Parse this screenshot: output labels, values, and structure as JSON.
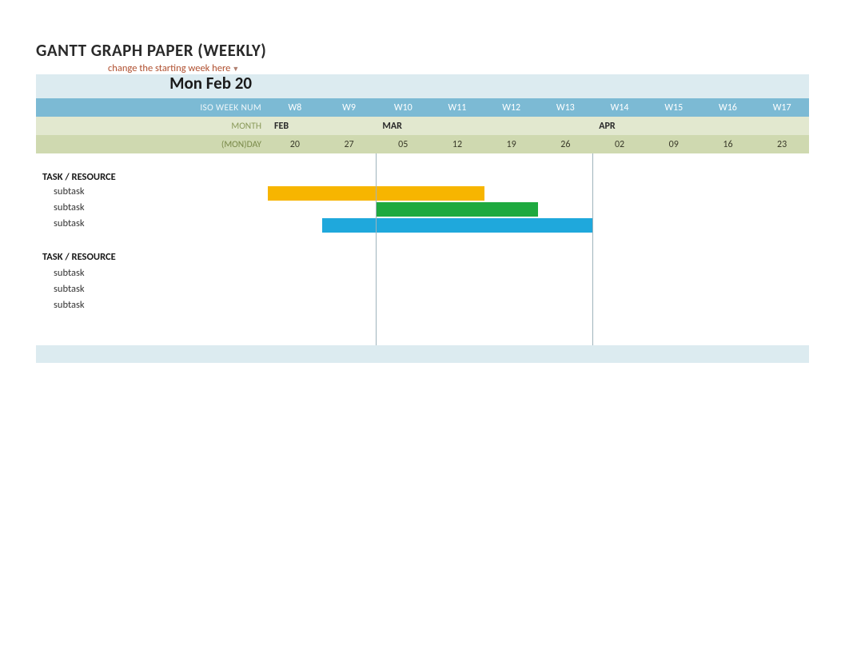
{
  "title": "GANTT GRAPH PAPER (WEEKLY)",
  "hint": "change the starting week here",
  "start_date": "Mon Feb 20",
  "header": {
    "iso_week_label": "ISO WEEK NUM",
    "month_label": "MONTH",
    "day_label": "(MON)DAY"
  },
  "weeks": [
    "W8",
    "W9",
    "W10",
    "W11",
    "W12",
    "W13",
    "W14",
    "W15",
    "W16",
    "W17"
  ],
  "months": [
    "FEB",
    "",
    "MAR",
    "",
    "",
    "",
    "APR",
    "",
    "",
    ""
  ],
  "month_bold": [
    true,
    false,
    true,
    false,
    false,
    false,
    true,
    false,
    false,
    false
  ],
  "month_boundaries": [
    2,
    6
  ],
  "days": [
    "20",
    "27",
    "05",
    "12",
    "19",
    "26",
    "02",
    "09",
    "16",
    "23"
  ],
  "sections": [
    {
      "heading": "TASK / RESOURCE",
      "rows": [
        {
          "label": "subtask",
          "bar": {
            "start": 0,
            "span": 4,
            "color": "yellow"
          }
        },
        {
          "label": "subtask",
          "bar": {
            "start": 2,
            "span": 3,
            "color": "green"
          }
        },
        {
          "label": "subtask",
          "bar": {
            "start": 1,
            "span": 5,
            "color": "blue"
          }
        }
      ]
    },
    {
      "heading": "TASK / RESOURCE",
      "rows": [
        {
          "label": "subtask",
          "bar": null
        },
        {
          "label": "subtask",
          "bar": null
        },
        {
          "label": "subtask",
          "bar": null
        }
      ]
    }
  ],
  "chart_data": {
    "type": "bar",
    "title": "GANTT GRAPH PAPER (WEEKLY)",
    "categories": [
      "W8",
      "W9",
      "W10",
      "W11",
      "W12",
      "W13",
      "W14",
      "W15",
      "W16",
      "W17"
    ],
    "x_dates": [
      "Feb 20",
      "Feb 27",
      "Mar 05",
      "Mar 12",
      "Mar 19",
      "Mar 26",
      "Apr 02",
      "Apr 09",
      "Apr 16",
      "Apr 23"
    ],
    "series": [
      {
        "name": "subtask",
        "group": "TASK / RESOURCE 1",
        "start_index": 0,
        "end_index": 3,
        "start_week": "W8",
        "end_week": "W11",
        "color": "#f7b500"
      },
      {
        "name": "subtask",
        "group": "TASK / RESOURCE 1",
        "start_index": 2,
        "end_index": 4,
        "start_week": "W10",
        "end_week": "W12",
        "color": "#1ea93f"
      },
      {
        "name": "subtask",
        "group": "TASK / RESOURCE 1",
        "start_index": 1,
        "end_index": 5,
        "start_week": "W9",
        "end_week": "W13",
        "color": "#1fa8dc"
      }
    ],
    "xlabel": "ISO WEEK NUM",
    "ylabel": ""
  }
}
